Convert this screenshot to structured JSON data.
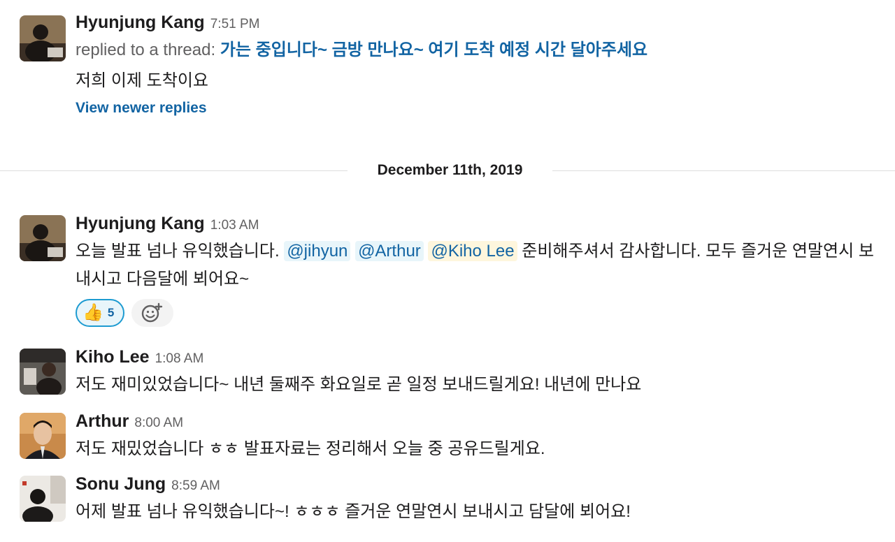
{
  "messages": [
    {
      "author": "Hyunjung Kang",
      "time": "7:51 PM",
      "thread_prefix": "replied to a thread:",
      "thread_text": "가는 중입니다~ 금방 만나요~ 여기 도착 예정 시간 달아주세요",
      "body": "저희 이제 도착이요",
      "view_newer": "View newer replies"
    },
    {
      "author": "Hyunjung Kang",
      "time": "1:03 AM",
      "body_before": "오늘 발표 넘나 유익했습니다.",
      "mentions": [
        "@jihyun",
        "@Arthur",
        "@Kiho Lee"
      ],
      "body_after": "준비해주셔서 감사합니다. 모두 즐거운 연말연시 보내시고 다음달에 뵈어요~",
      "reaction_emoji": "👍",
      "reaction_count": "5",
      "add_reaction_icon": "add-emoji-icon"
    },
    {
      "author": "Kiho Lee",
      "time": "1:08 AM",
      "body": "저도 재미있었습니다~ 내년 둘째주 화요일로 곧 일정 보내드릴게요! 내년에 만나요"
    },
    {
      "author": "Arthur",
      "time": "8:00 AM",
      "body": "저도 재밌었습니다 ㅎㅎ 발표자료는 정리해서 오늘 중 공유드릴게요."
    },
    {
      "author": "Sonu Jung",
      "time": "8:59 AM",
      "body": "어제 발표 넘나 유익했습니다~! ㅎㅎㅎ 즐거운 연말연시 보내시고 담달에 뵈어요!"
    }
  ],
  "date_divider": "December 11th, 2019",
  "colors": {
    "link": "#1264a3",
    "mention_bg": "#e8f5fa",
    "mention_self_bg": "#fef6dd",
    "reaction_border": "#1d9bd1",
    "meta_text": "#616061"
  }
}
